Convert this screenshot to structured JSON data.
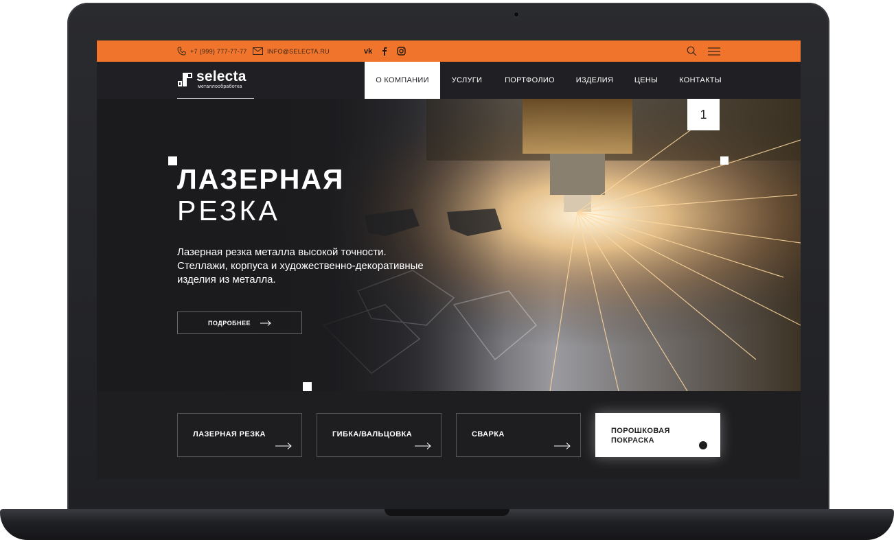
{
  "topbar": {
    "phone": "+7 (999) 777-77-77",
    "email": "INFO@SELECTA.RU",
    "social": [
      "vk-icon",
      "facebook-icon",
      "instagram-icon"
    ],
    "accent_color": "#f0742b"
  },
  "logo": {
    "name": "selecta",
    "subtitle": "металлообработка"
  },
  "nav": {
    "items": [
      "О КОМПАНИИ",
      "УСЛУГИ",
      "ПОРТФОЛИО",
      "ИЗДЕЛИЯ",
      "ЦЕНЫ",
      "КОНТАКТЫ"
    ],
    "active": "О КОМПАНИИ"
  },
  "hero": {
    "slide_number": "1",
    "title": "ЛАЗЕРНАЯ",
    "subtitle": "РЕЗКА",
    "text": "Лазерная резка металла высокой точности. Стеллажи, корпуса и художественно-декоративные изделия из металла.",
    "button": "ПОДРОБНЕЕ"
  },
  "services": [
    {
      "label": "ЛАЗЕРНАЯ РЕЗКА"
    },
    {
      "label": "ГИБКА/ВАЛЬЦОВКА"
    },
    {
      "label": "СВАРКА"
    },
    {
      "label": "ПОРОШКОВАЯ ПОКРАСКА",
      "label_line1": "ПОРОШКОВАЯ",
      "label_line2": "ПОКРАСКА",
      "active": true
    }
  ]
}
